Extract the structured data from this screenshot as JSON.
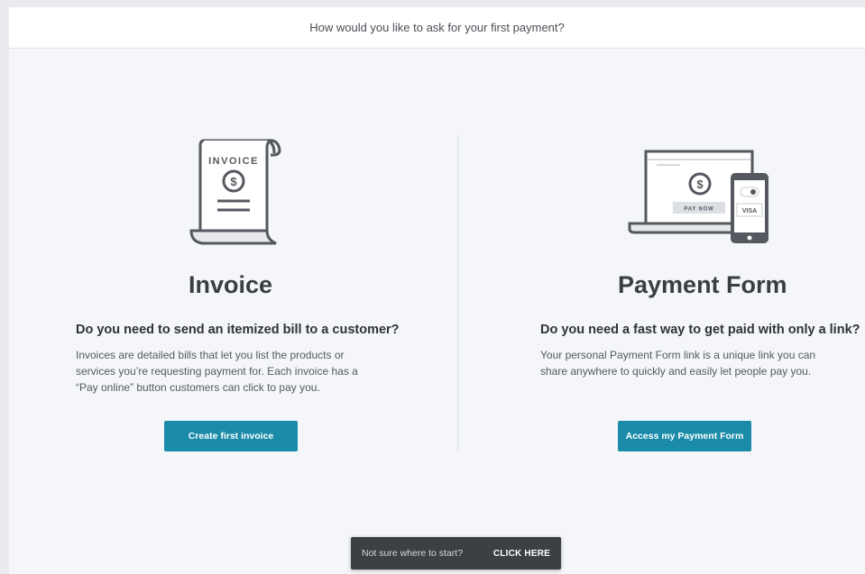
{
  "header": {
    "title": "How would you like to ask for your first payment?"
  },
  "options": {
    "invoice": {
      "illustration_text": "INVOICE",
      "title": "Invoice",
      "question": "Do you need to send an itemized bill to a customer?",
      "description": "Invoices are detailed bills that let you list the products or services you’re requesting payment for. Each invoice has a “Pay online” button customers can click to pay you.",
      "button_label": "Create first invoice"
    },
    "payment_form": {
      "illustration_text": "PAY NOW",
      "illustration_card_text": "VISA",
      "title": "Payment Form",
      "question": "Do you need a fast way to get paid with only a link?",
      "description": "Your personal Payment Form link is a unique link you can share anywhere to quickly and easily let people pay you.",
      "button_label": "Access my Payment Form"
    }
  },
  "toast": {
    "message": "Not sure where to start?",
    "action_label": "CLICK HERE"
  },
  "colors": {
    "accent": "#1a8ba8",
    "background": "#f4f6f9",
    "toast_bg": "#3c3f43"
  }
}
